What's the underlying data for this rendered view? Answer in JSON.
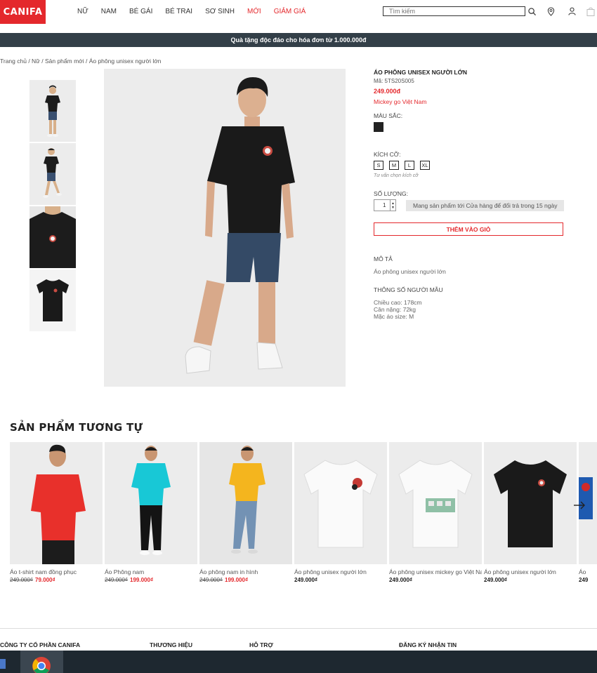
{
  "header": {
    "logo": "CANIFA",
    "nav": [
      "NỮ",
      "NAM",
      "BÉ GÁI",
      "BÉ TRAI",
      "SƠ SINH",
      "MỚI",
      "GIẢM GIÁ"
    ],
    "search_placeholder": "Tìm kiếm",
    "icons": [
      "search-icon",
      "location-pin-icon",
      "user-icon",
      "cart-icon"
    ]
  },
  "promo": "Quà tặng độc đáo cho hóa đơn từ 1.000.000đ",
  "breadcrumb": "Trang chủ / Nữ / Sản phẩm mới / Áo phông unisex người lớn",
  "product": {
    "title": "ÁO PHÔNG UNISEX NGƯỜI LỚN",
    "code": "Mã: 5TS20S005",
    "price": "249.000đ",
    "collection": "Mickey go Việt Nam",
    "color_label": "MÀU SẮC:",
    "color_hex": "#222222",
    "size_label": "KÍCH CỠ:",
    "sizes": [
      "S",
      "M",
      "L",
      "XL"
    ],
    "size_help": "Tư vấn chọn kích cỡ",
    "qty_label": "SỐ LƯỢNG:",
    "qty": "1",
    "store_note": "Mang sản phẩm tới Cửa hàng để đổi trả trong 15 ngày",
    "add_to_cart": "THÊM VÀO GIỎ",
    "desc_label": "MÔ TẢ",
    "desc": "Áo phông unisex người lớn",
    "model_label": "THÔNG SỐ NGƯỜI MẪU",
    "model_height": "Chiều cao: 178cm",
    "model_weight": "Cân nặng: 72kg",
    "model_size": "Mặc áo size: M"
  },
  "similar": {
    "title": "SẢN PHẨM TƯƠNG TỰ",
    "items": [
      {
        "name": "Áo t-shirt nam đồng phục",
        "old": "249.000₫",
        "price": "79.000₫"
      },
      {
        "name": "Áo Phông nam",
        "old": "249.000₫",
        "price": "199.000₫"
      },
      {
        "name": "Áo phông nam in hình",
        "old": "249.000₫",
        "price": "199.000₫"
      },
      {
        "name": "Áo phông unisex người lớn",
        "price": "249.000₫"
      },
      {
        "name": "Áo phông unisex mickey go Việt Nam",
        "price": "249.000₫"
      },
      {
        "name": "Áo phông unisex người lớn",
        "price": "249.000₫"
      },
      {
        "name": "Áo",
        "price": "249"
      }
    ]
  },
  "footer": {
    "col1": "CÔNG TY CỔ PHẦN CANIFA",
    "col2": "THƯƠNG HIỆU",
    "col3": "HỖ TRỢ",
    "col4": "ĐĂNG KÝ NHẬN TIN"
  },
  "colors": {
    "brand_red": "#e4282c",
    "promo_bar": "#333f48"
  }
}
